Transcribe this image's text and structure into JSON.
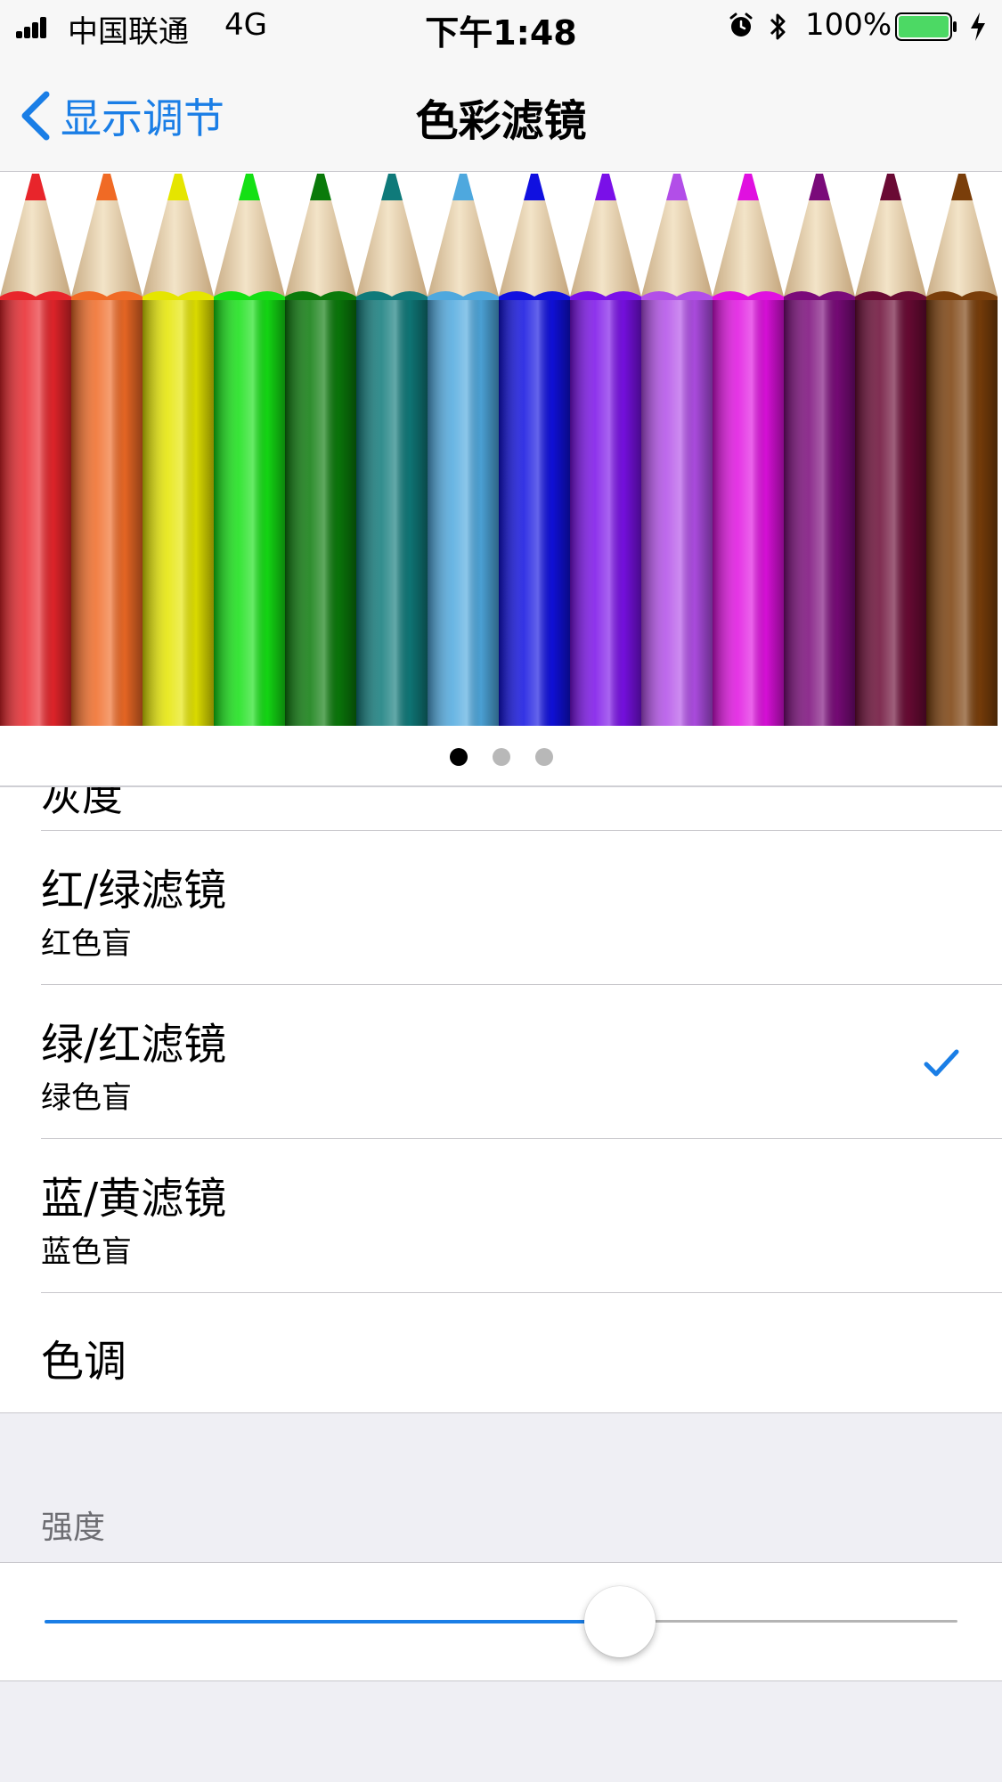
{
  "status_bar": {
    "carrier": "中国联通",
    "network": "4G",
    "time": "下午1:48",
    "battery": "100%",
    "battery_color": "#4cd964"
  },
  "nav": {
    "back_label": "显示调节",
    "title": "色彩滤镜",
    "accent_color": "#1a7ee6"
  },
  "pencils": {
    "colors": [
      "#e8252b",
      "#f06a25",
      "#e5e500",
      "#14e014",
      "#0a7a0a",
      "#0f7a7a",
      "#4ea8de",
      "#1010e0",
      "#7a10e8",
      "#b24ee8",
      "#e010e0",
      "#7a0a7a",
      "#6a0a34",
      "#7a3e0a"
    ]
  },
  "pager": {
    "count": 3,
    "active": 0
  },
  "list": {
    "partial_item": "灰度",
    "items": [
      {
        "title": "红/绿滤镜",
        "subtitle": "红色盲",
        "selected": false
      },
      {
        "title": "绿/红滤镜",
        "subtitle": "绿色盲",
        "selected": true
      },
      {
        "title": "蓝/黄滤镜",
        "subtitle": "蓝色盲",
        "selected": false
      },
      {
        "title": "色调",
        "subtitle": "",
        "selected": false
      }
    ]
  },
  "intensity": {
    "header": "强度",
    "value": 0.63
  }
}
